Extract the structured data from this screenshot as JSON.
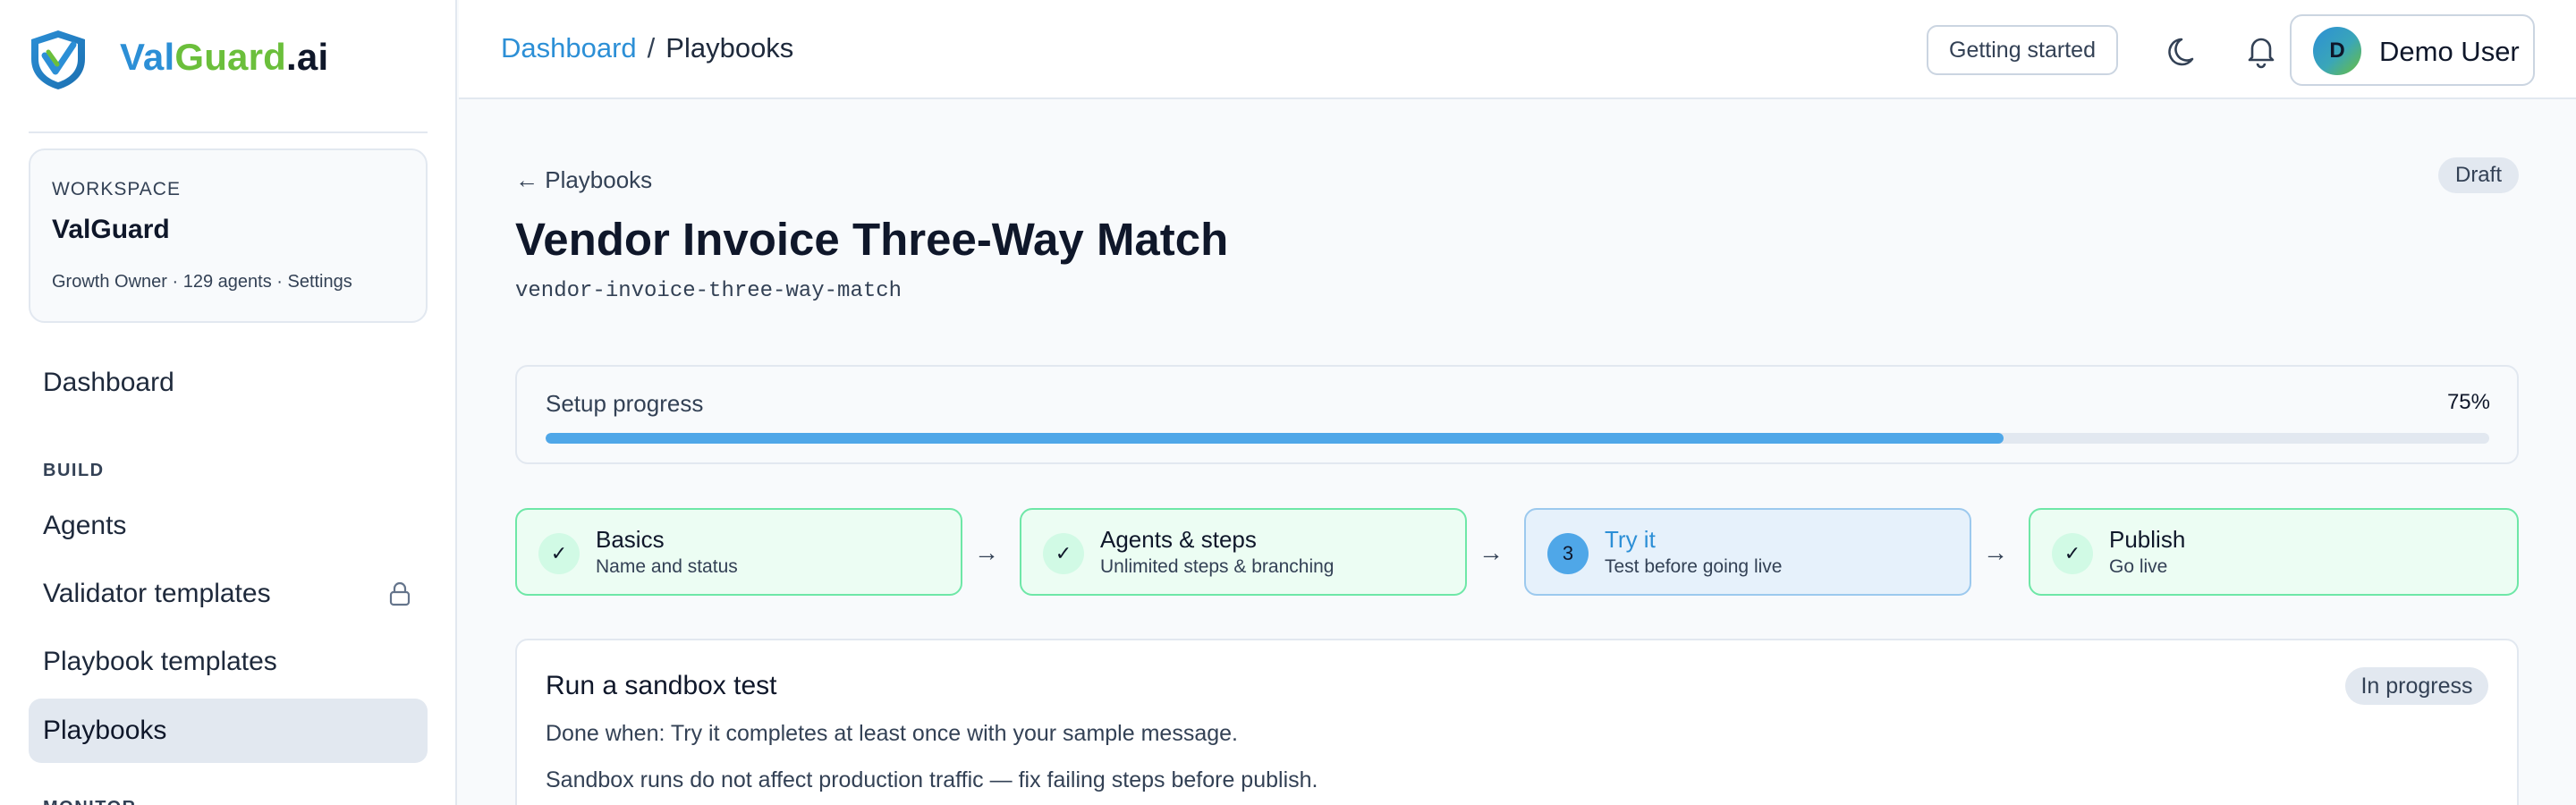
{
  "brand": {
    "name_part1": "Val",
    "name_part2": "Guard",
    "name_part3": ".ai",
    "logo_icon": "shield-check-logo"
  },
  "workspace": {
    "label": "WORKSPACE",
    "name": "ValGuard",
    "plan": "Growth Owner",
    "agents": "129 agents",
    "settings_label": "Settings",
    "separator": " · "
  },
  "sidebar": {
    "dashboard_label": "Dashboard",
    "build_section": "BUILD",
    "items": [
      {
        "label": "Agents",
        "locked": false
      },
      {
        "label": "Validator templates",
        "locked": true
      },
      {
        "label": "Playbook templates",
        "locked": false
      },
      {
        "label": "Playbooks",
        "locked": false,
        "active": true
      }
    ],
    "next_section_partial": "MONITOR"
  },
  "topbar": {
    "breadcrumb": {
      "root": "Dashboard",
      "separator": "/",
      "current": "Playbooks"
    },
    "getting_started_label": "Getting started",
    "theme_icon": "moon-icon",
    "notifications_icon": "bell-icon",
    "user": {
      "initial": "D",
      "name": "Demo User"
    }
  },
  "page": {
    "back_label": "← Playbooks",
    "status_badge": "Draft",
    "title": "Vendor Invoice Three-Way Match",
    "slug": "vendor-invoice-three-way-match"
  },
  "progress": {
    "label": "Setup progress",
    "percent_text": "75%",
    "value": 0.75
  },
  "steps": [
    {
      "marker": "✓",
      "title": "Basics",
      "subtitle": "Name and status",
      "state": "done"
    },
    {
      "marker": "✓",
      "title": "Agents & steps",
      "subtitle": "Unlimited steps & branching",
      "state": "done"
    },
    {
      "marker": "3",
      "title": "Try it",
      "subtitle": "Test before going live",
      "state": "current"
    },
    {
      "marker": "✓",
      "title": "Publish",
      "subtitle": "Go live",
      "state": "done"
    }
  ],
  "step_arrow": "→",
  "task": {
    "title": "Run a sandbox test",
    "status": "In progress",
    "done_when": "Done when: Try it completes at least once with your sample message.",
    "note": "Sandbox runs do not affect production traffic — fix failing steps before publish."
  },
  "colors": {
    "accent": "#2c8fd6",
    "brand_green": "#6bbf3b",
    "progress_fill": "#4fa7e8",
    "done_border": "#6ee7a7",
    "done_bg": "#ecfdf3",
    "current_bg": "#e6f1fb"
  }
}
